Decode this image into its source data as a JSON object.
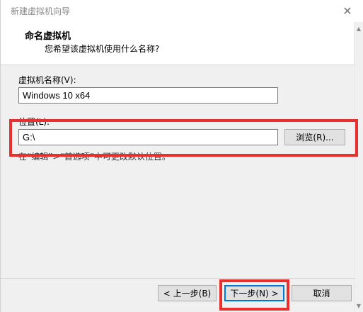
{
  "window": {
    "title": "新建虚拟机向导",
    "close_glyph": "✕"
  },
  "header": {
    "title": "命名虚拟机",
    "subtitle": "您希望该虚拟机使用什么名称?"
  },
  "form": {
    "name_label": "虚拟机名称(V):",
    "name_value": "Windows 10 x64",
    "location_label": "位置(L):",
    "location_value": "G:\\",
    "browse_label": "浏览(R)...",
    "hint": "在“编辑”>“首选项”中可更改默认位置。"
  },
  "footer": {
    "back_label": "< 上一步(B)",
    "next_label": "下一步(N) >",
    "cancel_label": "取消"
  },
  "colors": {
    "highlight": "#e8302f",
    "focus": "#0078d7"
  }
}
